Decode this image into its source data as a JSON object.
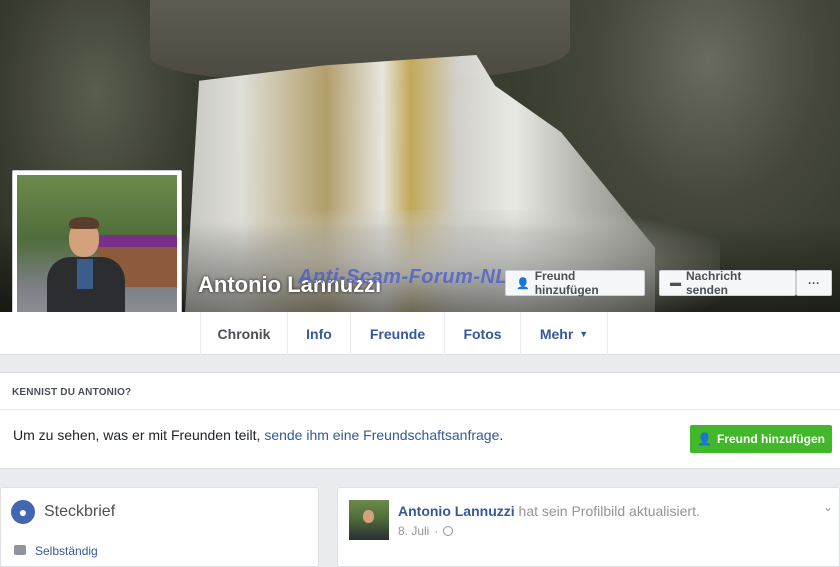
{
  "profile": {
    "name": "Antonio Lannuzzi",
    "watermark": "Anti-Scam-Forum-NL"
  },
  "cover_actions": {
    "add_friend": "Freund hinzufügen",
    "send_message": "Nachricht senden",
    "more": "···"
  },
  "tabs": [
    {
      "label": "Chronik",
      "active": true
    },
    {
      "label": "Info"
    },
    {
      "label": "Freunde"
    },
    {
      "label": "Fotos"
    },
    {
      "label": "Mehr"
    }
  ],
  "know_box": {
    "heading": "KENNIST DU ANTONIO?",
    "text": "Um zu sehen, was er mit Freunden teilt, ",
    "link": "sende ihm eine Freundschaftsanfrage",
    "suffix": ".",
    "button": "Freund hinzufügen"
  },
  "about": {
    "title": "Steckbrief",
    "work": "Selbständig"
  },
  "post": {
    "author": "Antonio Lannuzzi",
    "action": " hat sein Profilbild aktualisiert.",
    "date": "8. Juli",
    "separator": "·"
  },
  "colors": {
    "link": "#365899",
    "green": "#42b72a",
    "brand_blue": "#4267b2"
  }
}
